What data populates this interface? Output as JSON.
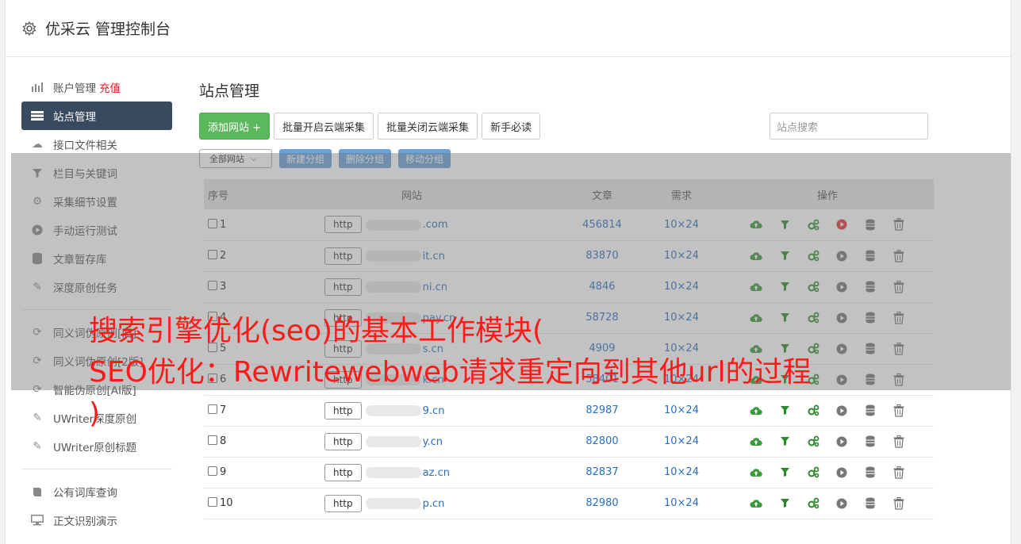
{
  "header": {
    "title": "优采云 管理控制台"
  },
  "sidebar": {
    "items": [
      {
        "label": "账户管理",
        "extra": "充值",
        "icon": "bar-chart-icon"
      },
      {
        "label": "站点管理",
        "icon": "server-icon",
        "active": true
      },
      {
        "label": "接口文件相关",
        "icon": "cloud-upload-icon"
      },
      {
        "label": "栏目与关键词",
        "icon": "filter-icon"
      },
      {
        "label": "采集细节设置",
        "icon": "gears-icon"
      },
      {
        "label": "手动运行测试",
        "icon": "play-icon"
      },
      {
        "label": "文章暂存库",
        "icon": "database-icon"
      },
      {
        "label": "深度原创任务",
        "icon": "edit-icon"
      },
      {
        "label": "同义词伪原创[旧]",
        "icon": "refresh-icon"
      },
      {
        "label": "同义词伪原创[2版]",
        "icon": "refresh-icon"
      },
      {
        "label": "智能伪原创[AI版]",
        "icon": "refresh-icon"
      },
      {
        "label": "UWriter深度原创",
        "icon": "edit-icon"
      },
      {
        "label": "UWriter原创标题",
        "icon": "edit-icon"
      },
      {
        "label": "公有词库查询",
        "icon": "book-icon"
      },
      {
        "label": "正文识别演示",
        "icon": "monitor-icon"
      }
    ]
  },
  "main": {
    "title": "站点管理",
    "buttons": {
      "add": "添加网站 +",
      "batch_on": "批量开启云端采集",
      "batch_off": "批量关闭云端采集",
      "guide": "新手必读"
    },
    "search_placeholder": "站点搜索",
    "group_select": "全部网站",
    "group_buttons": {
      "new": "新建分组",
      "delete": "删除分组",
      "move": "移动分组"
    },
    "table": {
      "headers": {
        "no": "序号",
        "site": "网站",
        "articles": "文章",
        "demand": "需求",
        "ops": "操作"
      },
      "rows": [
        {
          "no": "1",
          "proto": "http",
          "site": ".com",
          "articles": "456814",
          "demand": "10×24",
          "play_red": true
        },
        {
          "no": "2",
          "proto": "http",
          "site": "it.cn",
          "articles": "83870",
          "demand": "10×24"
        },
        {
          "no": "3",
          "proto": "http",
          "site": "ni.cn",
          "articles": "4846",
          "demand": "10×24"
        },
        {
          "no": "4",
          "proto": "http",
          "site": "pay.cn",
          "articles": "58728",
          "demand": "10×24"
        },
        {
          "no": "5",
          "proto": "http",
          "site": "s.cn",
          "articles": "4909",
          "demand": "10×24"
        },
        {
          "no": "6",
          "proto": "http",
          "site": "k.cn",
          "articles": "58401",
          "demand": "10×24"
        },
        {
          "no": "7",
          "proto": "http",
          "site": "9.cn",
          "articles": "82987",
          "demand": "10×24"
        },
        {
          "no": "8",
          "proto": "http",
          "site": "y.cn",
          "articles": "82800",
          "demand": "10×24"
        },
        {
          "no": "9",
          "proto": "http",
          "site": "az.cn",
          "articles": "82837",
          "demand": "10×24"
        },
        {
          "no": "10",
          "proto": "http",
          "site": "p.cn",
          "articles": "82980",
          "demand": "10×24"
        }
      ]
    }
  },
  "headline": {
    "line1": "搜索引擎优化(seo)的基本工作模块(",
    "line2": "SEO优化：Rewritewebweb请求重定向到其他url的过程",
    "line3": ")"
  },
  "colors": {
    "sidebar_active": "#3a4a5e",
    "green": "#5cb85c",
    "blue_btn": "#6aa1d8",
    "headline": "#ff1a1a",
    "link": "#2a6ebb"
  }
}
